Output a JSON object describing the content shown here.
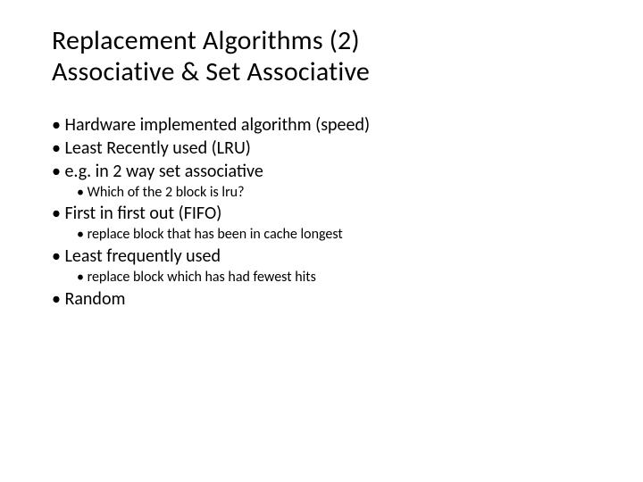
{
  "title_line1": "Replacement Algorithms (2)",
  "title_line2": "Associative & Set Associative",
  "bullets": {
    "b1": "Hardware implemented algorithm (speed)",
    "b2": "Least Recently used (LRU)",
    "b3": "e.g. in 2 way set associative",
    "b3_sub1": "Which of the 2 block is lru?",
    "b4": "First in first out (FIFO)",
    "b4_sub1": "replace block that has been in cache longest",
    "b5": "Least frequently used",
    "b5_sub1": "replace block which has had fewest hits",
    "b6": "Random"
  }
}
